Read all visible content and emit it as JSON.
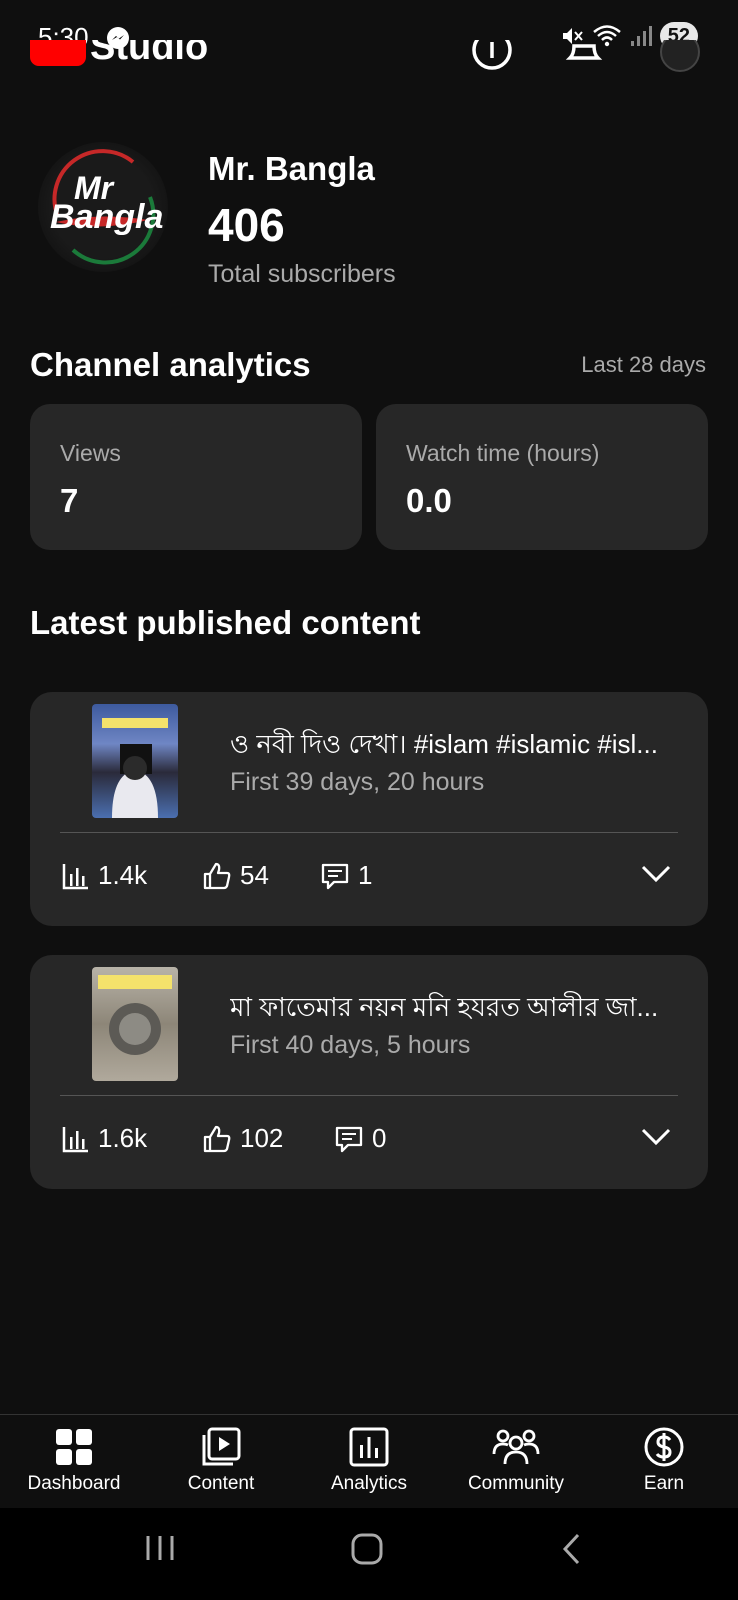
{
  "status_bar": {
    "time": "5:30",
    "battery": "52"
  },
  "header": {
    "app_name": "Studio"
  },
  "channel": {
    "name": "Mr. Bangla",
    "avatar_text_top": "Mr",
    "avatar_text_bottom": "Bangla",
    "subscriber_count": "406",
    "subscriber_label": "Total subscribers"
  },
  "analytics": {
    "title": "Channel analytics",
    "period": "Last 28 days",
    "metrics": [
      {
        "label": "Views",
        "value": "7"
      },
      {
        "label": "Watch time (hours)",
        "value": "0.0"
      }
    ]
  },
  "latest": {
    "title": "Latest published content",
    "videos": [
      {
        "title": "ও নবী দিও দেখা। #islam #islamic #isl...",
        "duration": "First 39 days, 20 hours",
        "views": "1.4k",
        "likes": "54",
        "comments": "1"
      },
      {
        "title": "মা ফাতেমার নয়ন মনি হযরত আলীর জা...",
        "duration": "First 40 days, 5 hours",
        "views": "1.6k",
        "likes": "102",
        "comments": "0"
      }
    ]
  },
  "nav": {
    "items": [
      {
        "label": "Dashboard",
        "icon": "dashboard-icon"
      },
      {
        "label": "Content",
        "icon": "content-icon"
      },
      {
        "label": "Analytics",
        "icon": "analytics-icon"
      },
      {
        "label": "Community",
        "icon": "community-icon"
      },
      {
        "label": "Earn",
        "icon": "earn-icon"
      }
    ]
  },
  "colors": {
    "background": "#0f0f0f",
    "card": "#272727",
    "accent": "#ff0000"
  }
}
